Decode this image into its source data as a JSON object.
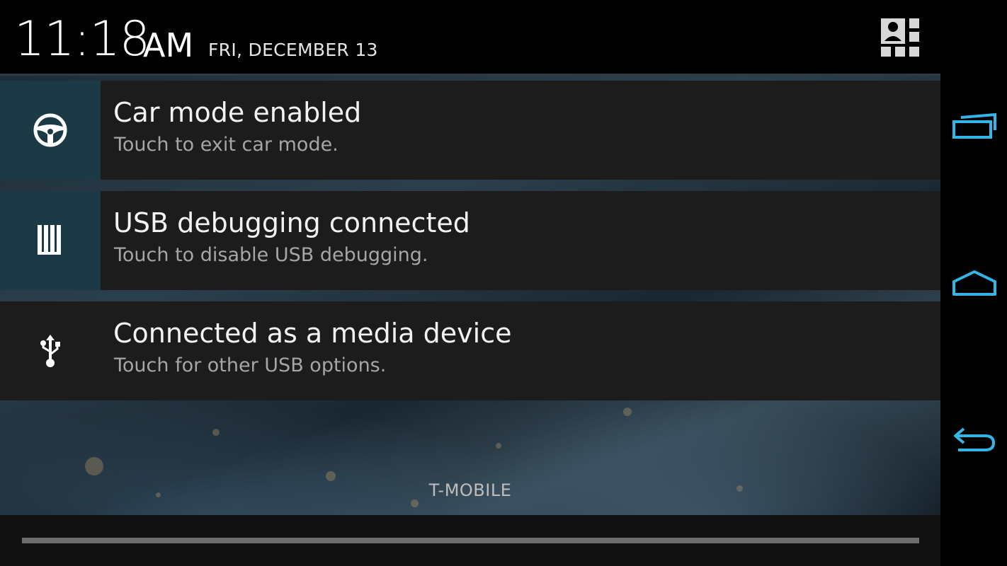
{
  "header": {
    "time": "11:18",
    "ampm": "AM",
    "date": "FRI, DECEMBER 13",
    "settings_icon": "quick-settings-icon"
  },
  "notifications": [
    {
      "icon": "steering-wheel-icon",
      "title": "Car mode enabled",
      "subtitle": "Touch to exit car mode."
    },
    {
      "icon": "usb-debugging-icon",
      "title": "USB debugging connected",
      "subtitle": "Touch to disable USB debugging."
    },
    {
      "icon": "usb-icon",
      "title": "Connected as a media device",
      "subtitle": "Touch for other USB options."
    }
  ],
  "carrier": "T-MOBILE",
  "navbar": {
    "recents_icon": "recent-apps-icon",
    "home_icon": "home-icon",
    "back_icon": "back-icon"
  },
  "colors": {
    "accent": "#33b5e5",
    "icon_bg": "#1b3a46",
    "notification_bg": "#1c1c1c"
  }
}
